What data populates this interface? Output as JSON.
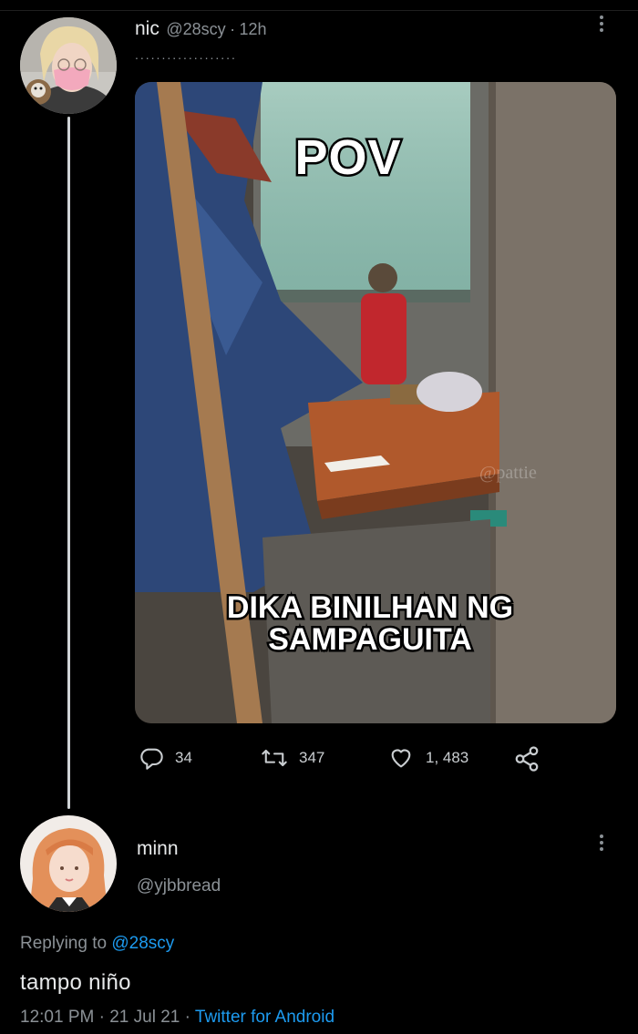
{
  "tweet": {
    "author_name": "nic",
    "author_handle": "@28scy",
    "separator": "·",
    "time": "12h",
    "dots": "...................",
    "media": {
      "top_text": "POV",
      "caption_line1": "DIKA BINILHAN NG",
      "caption_line2": "SAMPAGUITA",
      "watermark": "@pattie"
    },
    "stats": {
      "replies": "34",
      "retweets": "347",
      "likes": "1, 483"
    }
  },
  "reply": {
    "author_name": "minn",
    "author_handle": "@yjbbread",
    "replying_prefix": "Replying to",
    "replying_handle": "@28scy",
    "text": "tampo niño",
    "time": "12:01 PM",
    "date": "21 Jul 21",
    "source": "Twitter for Android",
    "separator": "·"
  },
  "colors": {
    "background": "#000000",
    "link": "#1d9bf0",
    "muted": "#8b9196"
  }
}
